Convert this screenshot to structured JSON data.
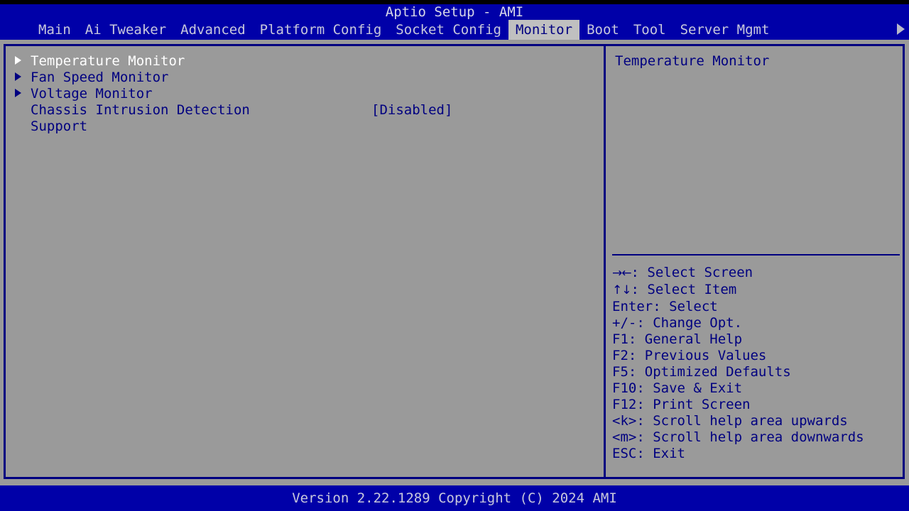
{
  "window": {
    "title": "Aptio Setup - AMI"
  },
  "menubar": {
    "items": [
      {
        "label": "Main",
        "selected": false
      },
      {
        "label": "Ai Tweaker",
        "selected": false
      },
      {
        "label": "Advanced",
        "selected": false
      },
      {
        "label": "Platform Config",
        "selected": false
      },
      {
        "label": "Socket Config",
        "selected": false
      },
      {
        "label": "Monitor",
        "selected": true
      },
      {
        "label": "Boot",
        "selected": false
      },
      {
        "label": "Tool",
        "selected": false
      },
      {
        "label": "Server Mgmt",
        "selected": false
      }
    ],
    "scroll_right_icon": "triangle-right-icon"
  },
  "main": {
    "items": [
      {
        "label": "Temperature Monitor",
        "value": "",
        "submenu": true,
        "selected": true,
        "continuation": ""
      },
      {
        "label": "Fan Speed Monitor",
        "value": "",
        "submenu": true,
        "selected": false,
        "continuation": ""
      },
      {
        "label": "Voltage Monitor",
        "value": "",
        "submenu": true,
        "selected": false,
        "continuation": ""
      },
      {
        "label": "Chassis Intrusion Detection",
        "value": "[Disabled]",
        "submenu": false,
        "selected": false,
        "continuation": "Support"
      }
    ]
  },
  "help": {
    "title": "Temperature Monitor",
    "keys": [
      {
        "glyph": "→←",
        "text": ": Select Screen"
      },
      {
        "glyph": "↑↓",
        "text": ": Select Item"
      },
      {
        "glyph": "",
        "text": "Enter: Select"
      },
      {
        "glyph": "",
        "text": "+/-: Change Opt."
      },
      {
        "glyph": "",
        "text": "F1: General Help"
      },
      {
        "glyph": "",
        "text": "F2: Previous Values"
      },
      {
        "glyph": "",
        "text": "F5: Optimized Defaults"
      },
      {
        "glyph": "",
        "text": "F10: Save & Exit"
      },
      {
        "glyph": "",
        "text": "F12: Print Screen"
      },
      {
        "glyph": "",
        "text": "<k>: Scroll help area upwards"
      },
      {
        "glyph": "",
        "text": "<m>: Scroll help area downwards"
      },
      {
        "glyph": "",
        "text": "ESC: Exit"
      }
    ]
  },
  "footer": {
    "version": "Version 2.22.1289 Copyright (C) 2024 AMI"
  },
  "colors": {
    "background": "#9a9a9a",
    "bar_blue": "#0000a8",
    "text_blue": "#000080",
    "text_light": "#c8c8dc",
    "selected_text": "#ffffff",
    "tab_highlight_bg": "#c0c0c0"
  }
}
